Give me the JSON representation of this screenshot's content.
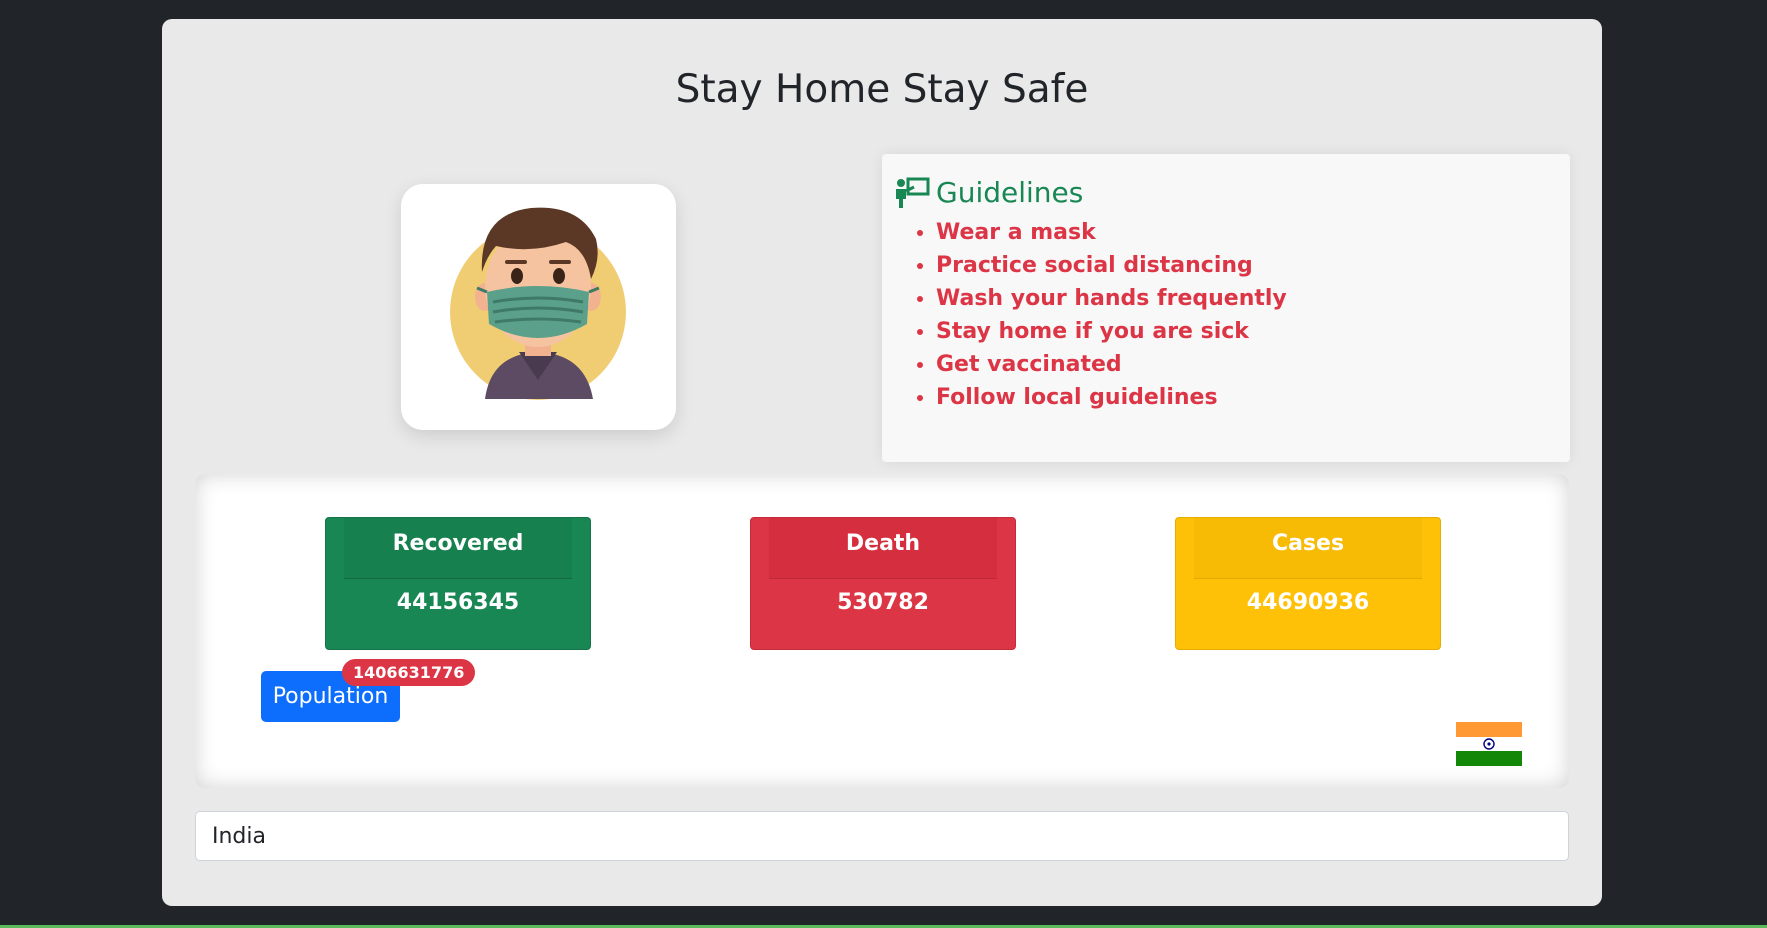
{
  "page": {
    "title": "Stay Home Stay Safe"
  },
  "avatar": {
    "icon": "masked-person-illustration"
  },
  "guidelines": {
    "heading": "Guidelines",
    "icon": "teacher-presentation-icon",
    "items": [
      "Wear a mask",
      "Practice social distancing",
      "Wash your hands frequently",
      "Stay home if you are sick",
      "Get vaccinated",
      "Follow local guidelines"
    ]
  },
  "stats": {
    "recovered": {
      "label": "Recovered",
      "value": "44156345",
      "color": "#198754"
    },
    "death": {
      "label": "Death",
      "value": "530782",
      "color": "#dc3545"
    },
    "cases": {
      "label": "Cases",
      "value": "44690936",
      "color": "#ffc107"
    }
  },
  "population": {
    "label": "Population",
    "value": "1406631776"
  },
  "flag": {
    "icon": "india-flag",
    "colors": [
      "#ff9933",
      "#ffffff",
      "#138808"
    ]
  },
  "search": {
    "value": "India"
  }
}
